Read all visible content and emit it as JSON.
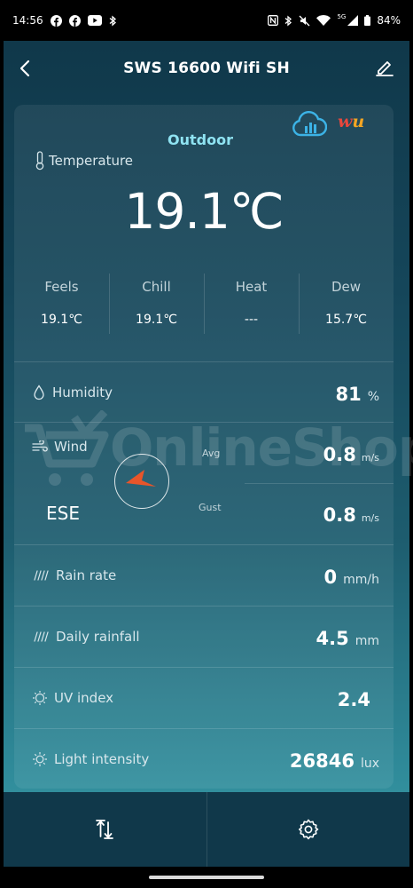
{
  "status_bar": {
    "time": "14:56",
    "network": "5G",
    "battery": "84%",
    "icons": [
      "facebook-icon",
      "facebook-icon",
      "youtube-icon",
      "bluetooth-icon",
      "nfc-icon",
      "bluetooth-icon",
      "mute-icon",
      "wifi-icon",
      "signal-icon",
      "battery-icon"
    ]
  },
  "header": {
    "title": "SWS 16600 Wifi SH",
    "back_icon": "chevron-left-icon",
    "edit_icon": "pencil-icon"
  },
  "outdoor": {
    "label": "Outdoor",
    "temperature_label": "Temperature",
    "temperature_value": "19.1℃",
    "sub_readings": [
      {
        "label": "Feels",
        "value": "19.1℃"
      },
      {
        "label": "Chill",
        "value": "19.1℃"
      },
      {
        "label": "Heat",
        "value": "---"
      },
      {
        "label": "Dew",
        "value": "15.7℃"
      }
    ]
  },
  "humidity": {
    "label": "Humidity",
    "value": "81",
    "unit": "%",
    "icon": "droplet-icon"
  },
  "wind": {
    "label": "Wind",
    "icon": "wind-icon",
    "direction": "ESE",
    "avg_label": "Avg",
    "avg_value": "0.8",
    "avg_unit": "m/s",
    "gust_label": "Gust",
    "gust_value": "0.8",
    "gust_unit": "m/s",
    "arrow_color": "#e8552a"
  },
  "rain_rate": {
    "label": "Rain rate",
    "value": "0",
    "unit": "mm/h",
    "icon": "rain-icon"
  },
  "daily_rainfall": {
    "label": "Daily rainfall",
    "value": "4.5",
    "unit": "mm",
    "icon": "rain-icon"
  },
  "uv_index": {
    "label": "UV index",
    "value": "2.4",
    "icon": "uv-sun-icon"
  },
  "light_intensity": {
    "label": "Light intensity",
    "value": "26846",
    "unit": "lux",
    "icon": "sun-icon"
  },
  "watermark": {
    "text": "OnlineShop"
  },
  "bottom_bar": {
    "left_icon": "sort-arrows-icon",
    "right_icon": "settings-gear-icon"
  },
  "colors": {
    "accent": "#8fe3f2",
    "header_bg": "#10384a",
    "arrow": "#e8552a"
  }
}
